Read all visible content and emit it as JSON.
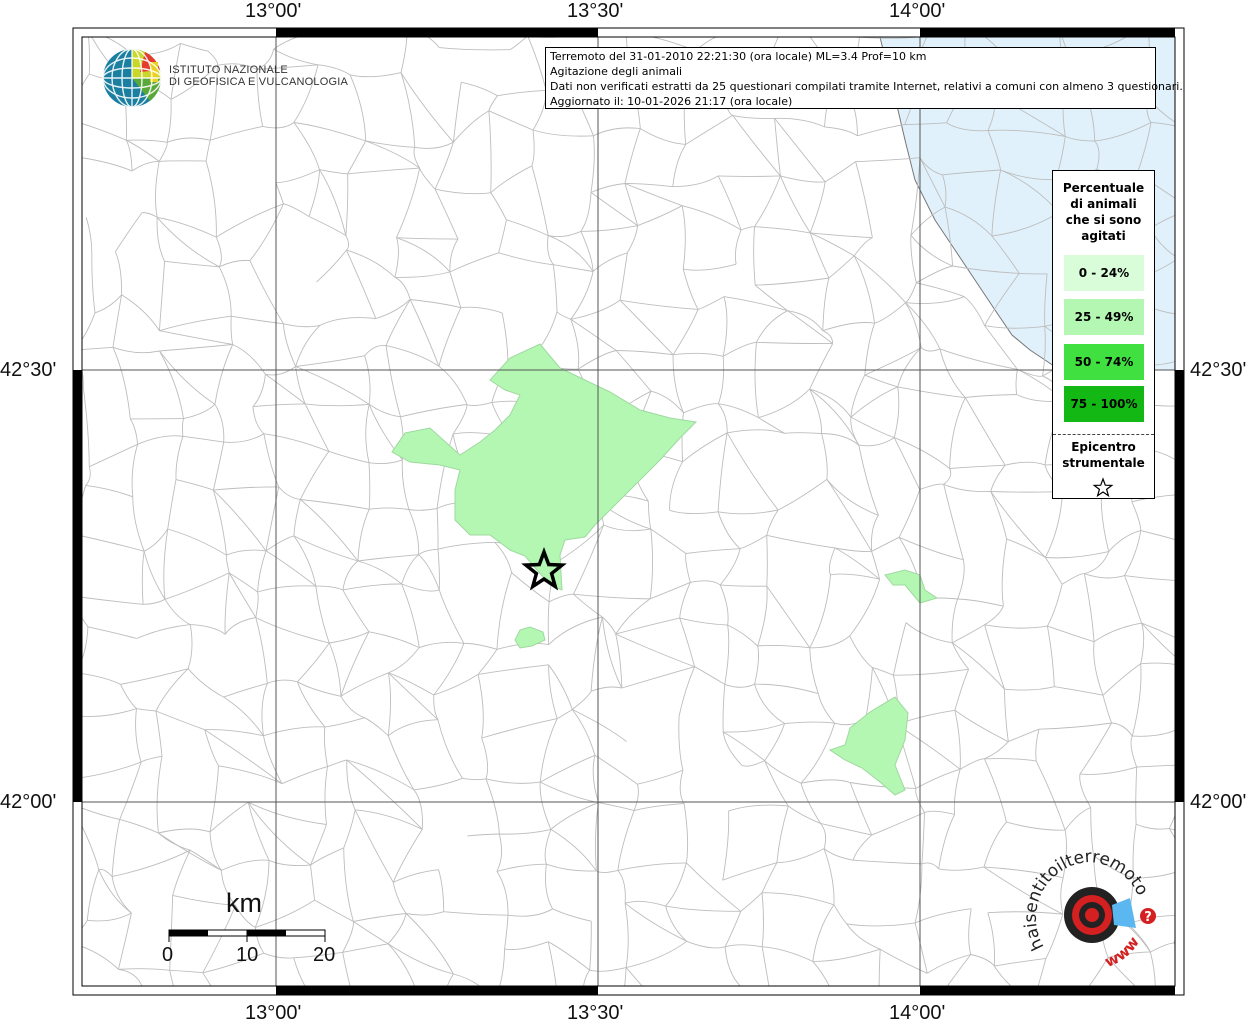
{
  "title_box": {
    "line1": "Terremoto del 31-01-2010 22:21:30 (ora locale) ML=3.4 Prof=10 km",
    "line2": "Agitazione degli animali",
    "line3": "Dati non verificati estratti da 25 questionari compilati tramite Internet, relativi a comuni con almeno 3 questionari.",
    "line4": "Aggiornato il: 10-01-2026 21:17 (ora locale)"
  },
  "logo": {
    "line1": "ISTITUTO NAZIONALE",
    "line2": "DI GEOFISICA E VULCANOLOGIA"
  },
  "axes": {
    "top_ticks": [
      "13°00'",
      "13°30'",
      "14°00'"
    ],
    "bottom_ticks": [
      "13°00'",
      "13°30'",
      "14°00'"
    ],
    "left_ticks": [
      "42°30'",
      "42°00'"
    ],
    "right_ticks": [
      "42°30'",
      "42°00'"
    ]
  },
  "legend": {
    "title_lines": [
      "Percentuale",
      "di animali",
      "che si sono",
      "agitati"
    ],
    "classes": [
      {
        "label": "0 - 24%",
        "color": "#d9fcd9"
      },
      {
        "label": "25 - 49%",
        "color": "#b3f7b3"
      },
      {
        "label": "50 - 74%",
        "color": "#3fe03f"
      },
      {
        "label": "75 - 100%",
        "color": "#14b814"
      }
    ],
    "epicenter_lines": [
      "Epicentro",
      "strumentale"
    ],
    "epicenter_icon": "star-icon"
  },
  "scale_bar": {
    "unit": "km",
    "labels": [
      "0",
      "10",
      "20"
    ]
  },
  "haisentito": {
    "text": "haisentitoilterremoto.it",
    "www": "www.",
    "question": "?"
  },
  "colors": {
    "sea": "#e0f1fb",
    "felt_25_49": "#b3f7b3",
    "boundary": "#bdbdbd",
    "graticule": "#555555"
  }
}
